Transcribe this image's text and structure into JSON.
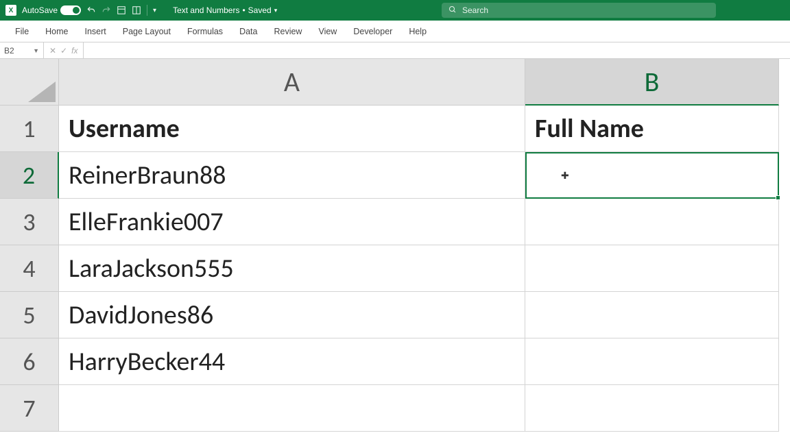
{
  "titlebar": {
    "autosave_label": "AutoSave",
    "autosave_state": "On",
    "doc_name": "Text and Numbers",
    "save_state": "Saved",
    "search_placeholder": "Search"
  },
  "ribbon": {
    "tabs": [
      "File",
      "Home",
      "Insert",
      "Page Layout",
      "Formulas",
      "Data",
      "Review",
      "View",
      "Developer",
      "Help"
    ]
  },
  "formula_bar": {
    "name_box": "B2",
    "fx_label": "fx",
    "formula": ""
  },
  "columns": [
    "A",
    "B"
  ],
  "rows": [
    "1",
    "2",
    "3",
    "4",
    "5",
    "6",
    "7"
  ],
  "selected_cell": "B2",
  "data": {
    "A1": "Username",
    "B1": "Full Name",
    "A2": "ReinerBraun88",
    "A3": "ElleFrankie007",
    "A4": "LaraJackson555",
    "A5": "DavidJones86",
    "A6": "HarryBecker44"
  }
}
